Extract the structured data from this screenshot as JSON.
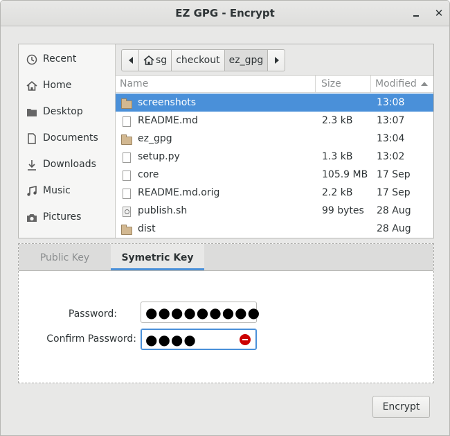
{
  "window": {
    "title": "EZ GPG - Encrypt"
  },
  "places": [
    {
      "label": "Recent",
      "icon": "clock-icon"
    },
    {
      "label": "Home",
      "icon": "home-icon"
    },
    {
      "label": "Desktop",
      "icon": "desktop-icon"
    },
    {
      "label": "Documents",
      "icon": "document-icon"
    },
    {
      "label": "Downloads",
      "icon": "download-icon"
    },
    {
      "label": "Music",
      "icon": "music-icon"
    },
    {
      "label": "Pictures",
      "icon": "camera-icon"
    }
  ],
  "pathbar": {
    "crumbs": [
      "sg",
      "checkout",
      "ez_gpg"
    ],
    "active": "ez_gpg"
  },
  "filelist": {
    "columns": {
      "name": "Name",
      "size": "Size",
      "modified": "Modified"
    },
    "rows": [
      {
        "name": "screenshots",
        "size": "",
        "modified": "13:08",
        "type": "folder",
        "selected": true
      },
      {
        "name": "README.md",
        "size": "2.3 kB",
        "modified": "13:07",
        "type": "file"
      },
      {
        "name": "ez_gpg",
        "size": "",
        "modified": "13:04",
        "type": "folder"
      },
      {
        "name": "setup.py",
        "size": "1.3 kB",
        "modified": "13:02",
        "type": "file"
      },
      {
        "name": "core",
        "size": "105.9 MB",
        "modified": "17 Sep",
        "type": "file"
      },
      {
        "name": "README.md.orig",
        "size": "2.2 kB",
        "modified": "17 Sep",
        "type": "file"
      },
      {
        "name": "publish.sh",
        "size": "99 bytes",
        "modified": "28 Aug",
        "type": "script"
      },
      {
        "name": "dist",
        "size": "",
        "modified": "28 Aug",
        "type": "folder"
      }
    ]
  },
  "tabs": [
    {
      "label": "Public Key",
      "active": false
    },
    {
      "label": "Symetric Key",
      "active": true
    }
  ],
  "form": {
    "password_label": "Password:",
    "password_value": "●●●●●●●●●",
    "confirm_label": "Confirm Password:",
    "confirm_value": "●●●●"
  },
  "buttons": {
    "encrypt": "Encrypt"
  },
  "colors": {
    "accent": "#4a90d9",
    "error": "#cc0000"
  }
}
